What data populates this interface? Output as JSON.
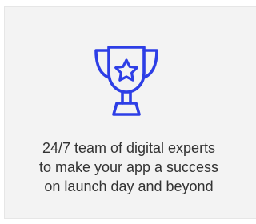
{
  "card": {
    "icon": "trophy-star-icon",
    "accent_color": "#2d3ee6",
    "text_lines": [
      "24/7 team of digital experts",
      "to make your app a success",
      "on launch day and beyond"
    ]
  }
}
